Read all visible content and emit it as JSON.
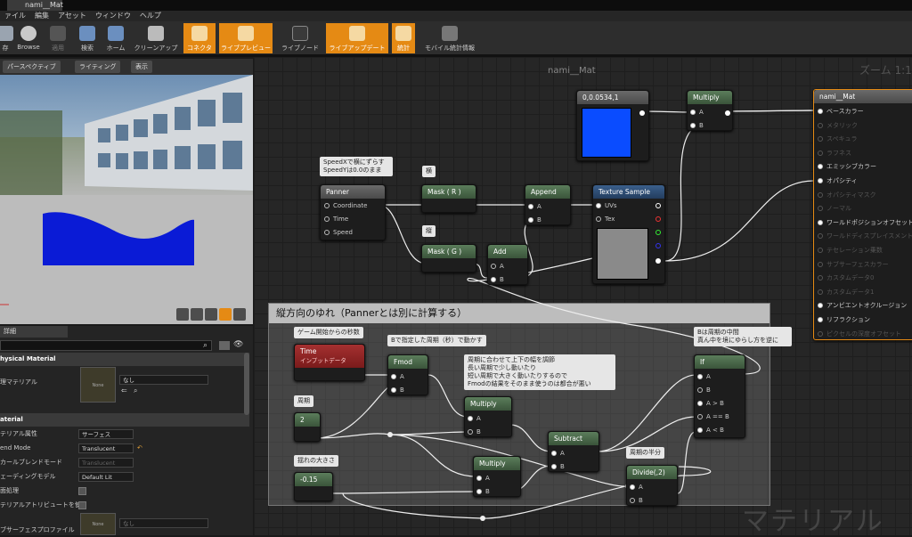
{
  "titlebar": {
    "tab": "nami__Mat"
  },
  "menu": [
    "ァイル",
    "編集",
    "アセット",
    "ウィンドウ",
    "ヘルプ"
  ],
  "toolbar": {
    "save": "存",
    "browse": "Browse",
    "apply": "適用",
    "search": "検索",
    "home": "ホーム",
    "cleanup": "クリーンアップ",
    "connect": "コネクタ",
    "live_preview": "ライブプレビュー",
    "live_node": "ライブノード",
    "live_update": "ライブアップデート",
    "stats": "統計",
    "mobile_stats": "モバイル統計情報"
  },
  "viewport": {
    "perspective": "パースペクティブ",
    "lighting": "ライティング",
    "show": "表示"
  },
  "details": {
    "tab": "詳細",
    "cat_physical": "hysical Material",
    "phys_mat_label": "理マテリアル",
    "none1": "None",
    "nashi1": "なし",
    "cat_material": "aterial",
    "mat_domain_label": "テリアル属性",
    "mat_domain": "サーフェス",
    "blend_label": "end Mode",
    "blend": "Translucent",
    "decal_label": "カールブレンドモード",
    "decal": "Translucent",
    "shading_label": "ェーディングモデル",
    "shading": "Default Lit",
    "two_sided_label": "面処理",
    "use_attr_label": "テリアルアトリビュートを使",
    "subsurface_label": "ブサーフェスプロファイル",
    "none2": "None",
    "nashi2": "なし"
  },
  "graph": {
    "title": "nami__Mat",
    "zoom": "ズーム 1:1",
    "watermark": "マテリアル",
    "comment_group": "縦方向のゆれ（Pannerとは別に計算する）",
    "const_vec": "0,0.0534,1",
    "panner": {
      "title": "Panner",
      "in": [
        "Coordinate",
        "Time",
        "Speed"
      ]
    },
    "mask_r": "Mask ( R )",
    "mask_g": "Mask ( G )",
    "append": "Append",
    "add": "Add",
    "multiply": "Multiply",
    "tex": "Texture Sample",
    "uvs": "UVs",
    "tex_in": "Tex",
    "fmod": "Fmod",
    "multiply2": "Multiply",
    "multiply3": "Multiply",
    "subtract": "Subtract",
    "divide": "Divide(,2)",
    "if": "If",
    "time": "Time",
    "time_sub": "インプットデータ",
    "c2": "2",
    "c015": "-0.15",
    "pin_a": "A",
    "pin_b": "B",
    "pin_agb": "A > B",
    "pin_aeb": "A == B",
    "pin_alb": "A < B",
    "comments": {
      "speed": "SpeedXで横にずらす\nSpeedYは0.0のまま",
      "yoko": "横",
      "tate": "縦",
      "start": "ゲーム開始からの秒数",
      "period_b": "Bで指定した周期（秒）で動かす",
      "explain": "周期に合わせて上下の幅を調節\n長い周期で少し動いたり\n短い周期で大きく動いたりするので\nFmodの結果をそのまま使うのは都合が悪い",
      "if_note": "Bは周期の中間\n真ん中を境にゆらし方を逆に",
      "shuki": "周期",
      "haba": "揺れの大きさ",
      "half": "周期の半分"
    },
    "result": {
      "title": "nami__Mat",
      "pins": [
        "ベースカラー",
        "メタリック",
        "スペキュラ",
        "ラフネス",
        "エミッシブカラー",
        "オパシティ",
        "オパシティマスク",
        "ノーマル",
        "ワールドポジションオフセット",
        "ワールドディスプレイスメント",
        "テセレーション乗数",
        "サブサーフェスカラー",
        "カスタムデータ0",
        "カスタムデータ1",
        "アンビエントオクルージョン",
        "リフラクション",
        "ピクセルの深度オフセット"
      ],
      "active": [
        0,
        4,
        5,
        8,
        14,
        15
      ]
    }
  }
}
